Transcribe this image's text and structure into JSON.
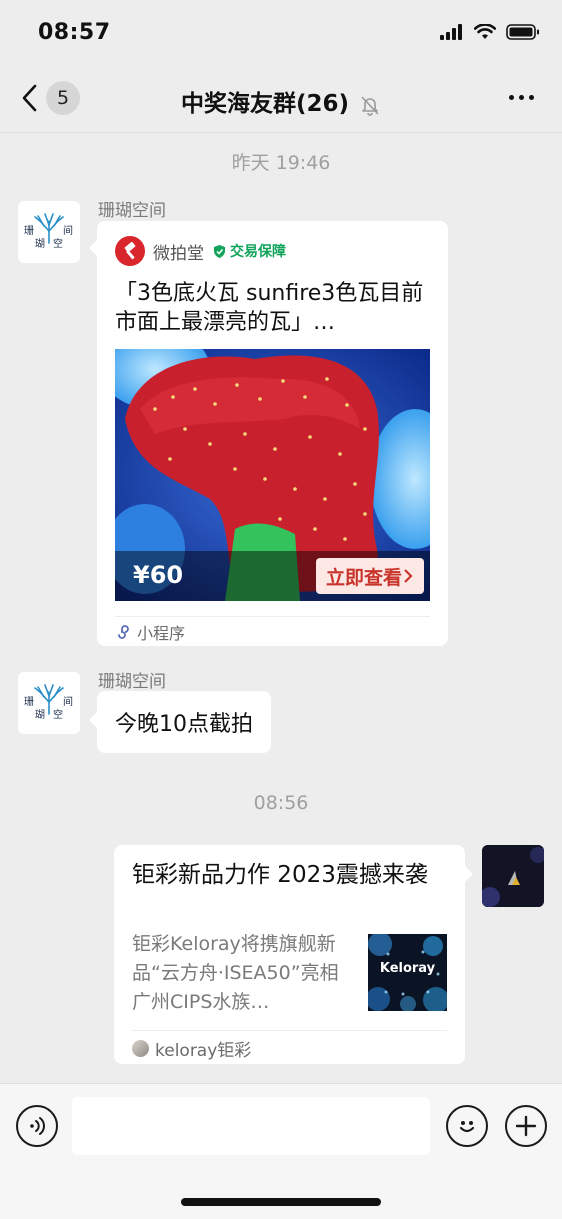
{
  "status": {
    "time": "08:57"
  },
  "nav": {
    "unread": "5",
    "title": "中奖海友群(26)"
  },
  "timestamps": {
    "first": "昨天 19:46",
    "second": "08:56"
  },
  "messages": [
    {
      "sender": "珊瑚空间",
      "avatar_text": [
        "珊",
        "间",
        "瑚",
        "空"
      ],
      "mini_program": {
        "app_name": "微拍堂",
        "badge": "交易保障",
        "title": "「3色底火瓦 sunfire3色瓦目前市面上最漂亮的瓦」…",
        "price": "¥60",
        "cta": "立即查看",
        "footer": "小程序"
      }
    },
    {
      "sender": "珊瑚空间",
      "text": "今晚10点截拍"
    },
    {
      "article": {
        "title": "钜彩新品力作 2023震撼来袭",
        "description": "钜彩Keloray将携旗舰新品“云方舟·ISEA50”亮相广州CIPS水族…",
        "thumb_text": "Keloray",
        "source": "keloray钜彩"
      }
    }
  ],
  "colors": {
    "background": "#ededed",
    "mp_red": "#d8262c",
    "guarantee_green": "#12a35b",
    "cta_red": "#c8342b"
  }
}
